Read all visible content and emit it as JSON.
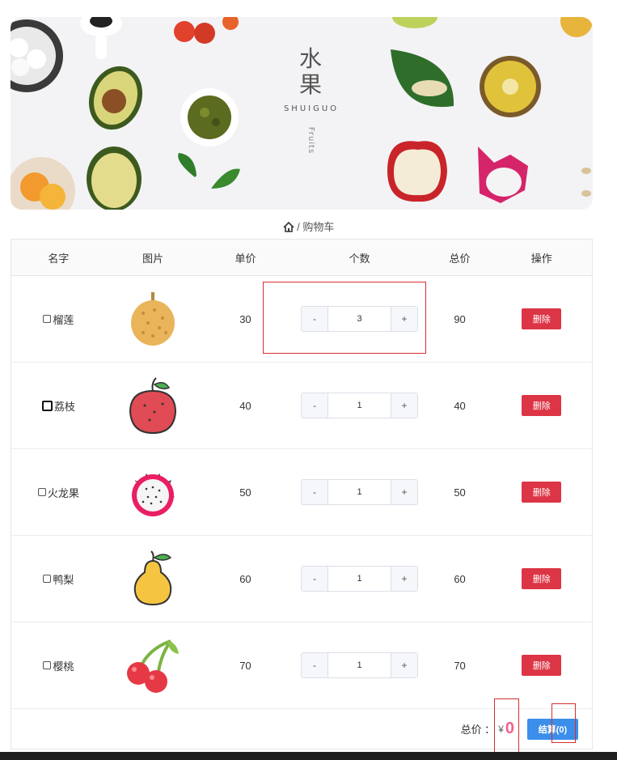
{
  "banner": {
    "title_zh_1": "水",
    "title_zh_2": "果",
    "title_en": "SHUIGUO",
    "title_vertical": "Fruits"
  },
  "breadcrumb": {
    "home_icon": "home-icon",
    "separator": "/",
    "current": "购物车"
  },
  "table": {
    "headers": {
      "name": "名字",
      "image": "图片",
      "price": "单价",
      "quantity": "个数",
      "total": "总价",
      "operation": "操作"
    },
    "rows": [
      {
        "name": "榴莲",
        "image": "durian-icon",
        "price": "30",
        "quantity": "3",
        "total": "90",
        "delete_label": "删除",
        "minus": "-",
        "plus": "+"
      },
      {
        "name": "荔枝",
        "image": "lychee-icon",
        "price": "40",
        "quantity": "1",
        "total": "40",
        "delete_label": "删除",
        "minus": "-",
        "plus": "+"
      },
      {
        "name": "火龙果",
        "image": "dragonfruit-icon",
        "price": "50",
        "quantity": "1",
        "total": "50",
        "delete_label": "删除",
        "minus": "-",
        "plus": "+"
      },
      {
        "name": "鸭梨",
        "image": "pear-icon",
        "price": "60",
        "quantity": "1",
        "total": "60",
        "delete_label": "删除",
        "minus": "-",
        "plus": "+"
      },
      {
        "name": "樱桃",
        "image": "cherry-icon",
        "price": "70",
        "quantity": "1",
        "total": "70",
        "delete_label": "删除",
        "minus": "-",
        "plus": "+"
      }
    ]
  },
  "footer": {
    "total_label": "总价 ：",
    "currency": "¥",
    "total_value": "0",
    "checkout_label": "结算(0)"
  },
  "colors": {
    "delete": "#dc3545",
    "checkout": "#3b8eea",
    "total_value": "#f06292",
    "annotation": "#d32f2f"
  }
}
